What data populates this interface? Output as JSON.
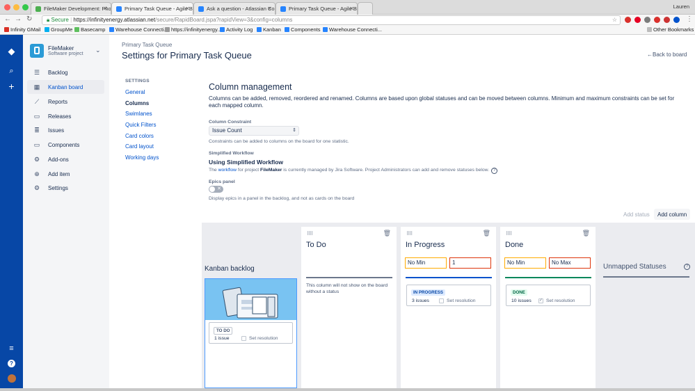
{
  "browser": {
    "tabs": [
      {
        "title": "FileMaker Development: Photo...",
        "color": "#4caf50"
      },
      {
        "title": "Primary Task Queue - Agile Bo...",
        "color": "#2684ff"
      },
      {
        "title": "Ask a question - Atlassian Com...",
        "color": "#2684ff"
      },
      {
        "title": "Primary Task Queue - Agile Bo...",
        "color": "#2684ff"
      }
    ],
    "user": "Lauren",
    "url_secure": "Secure",
    "url_host": "https://infinityenergy.atlassian.net",
    "url_path": "/secure/RapidBoard.jspa?rapidView=3&config=columns",
    "bookmarks": [
      "Infinity GMail",
      "GroupMe",
      "Basecamp",
      "Warehouse Connecti...",
      "https://infinityenergy...",
      "Activity Log",
      "Kanban",
      "Components",
      "Warehouse Connecti..."
    ],
    "other_bookmarks": "Other Bookmarks"
  },
  "project": {
    "name": "FileMaker",
    "type": "Software project"
  },
  "sidebar": {
    "items": [
      {
        "label": "Backlog",
        "icon": "backlog-icon"
      },
      {
        "label": "Kanban board",
        "icon": "board-icon"
      },
      {
        "label": "Reports",
        "icon": "reports-icon"
      },
      {
        "label": "Releases",
        "icon": "releases-icon"
      },
      {
        "label": "Issues",
        "icon": "issues-icon"
      },
      {
        "label": "Components",
        "icon": "components-icon"
      },
      {
        "label": "Add-ons",
        "icon": "addons-icon"
      },
      {
        "label": "Add item",
        "icon": "add-item-icon"
      },
      {
        "label": "Settings",
        "icon": "settings-icon"
      }
    ]
  },
  "header": {
    "breadcrumb": "Primary Task Queue",
    "title": "Settings for Primary Task Queue",
    "back": "Back to board"
  },
  "settings_nav": {
    "label": "SETTINGS",
    "items": [
      "General",
      "Columns",
      "Swimlanes",
      "Quick Filters",
      "Card colors",
      "Card layout",
      "Working days"
    ],
    "current": "Columns"
  },
  "column_mgmt": {
    "title": "Column management",
    "description": "Columns can be added, removed, reordered and renamed. Columns are based upon global statuses and can be moved between columns. Minimum and maximum constraints can be set for each mapped column.",
    "constraint_label": "Column Constraint",
    "constraint_value": "Issue Count",
    "constraint_help": "Constraints can be added to columns on the board for one statistic.",
    "workflow_label": "Simplified Workflow",
    "workflow_title": "Using Simplified Workflow",
    "workflow_pre": "The ",
    "workflow_link": "workflow",
    "workflow_mid": " for project ",
    "workflow_project": "FileMaker",
    "workflow_post": " is currently managed by Jira Software. Project Administrators can add and remove statuses below.",
    "epics_label": "Epics panel",
    "epics_desc": "Display epics in a panel in the backlog, and not as cards on the board",
    "add_status": "Add status",
    "add_column": "Add column"
  },
  "columns": {
    "kanban": {
      "title": "Kanban backlog",
      "status": "TO DO",
      "count": "1 issue",
      "resolution": "Set resolution"
    },
    "todo": {
      "title": "To Do",
      "note": "This column will not show on the board without a status"
    },
    "inprogress": {
      "title": "In Progress",
      "min": "No Min",
      "max": "1",
      "status": "IN PROGRESS",
      "count": "3 issues",
      "resolution": "Set resolution"
    },
    "done": {
      "title": "Done",
      "min": "No Min",
      "max": "No Max",
      "status": "DONE",
      "count": "10 issues",
      "resolution": "Set resolution"
    },
    "unmapped": {
      "title": "Unmapped Statuses"
    }
  },
  "colors": {
    "accent": "#0052cc",
    "nav": "#0747a6",
    "inprogress": "#0052cc",
    "done": "#00875a"
  }
}
